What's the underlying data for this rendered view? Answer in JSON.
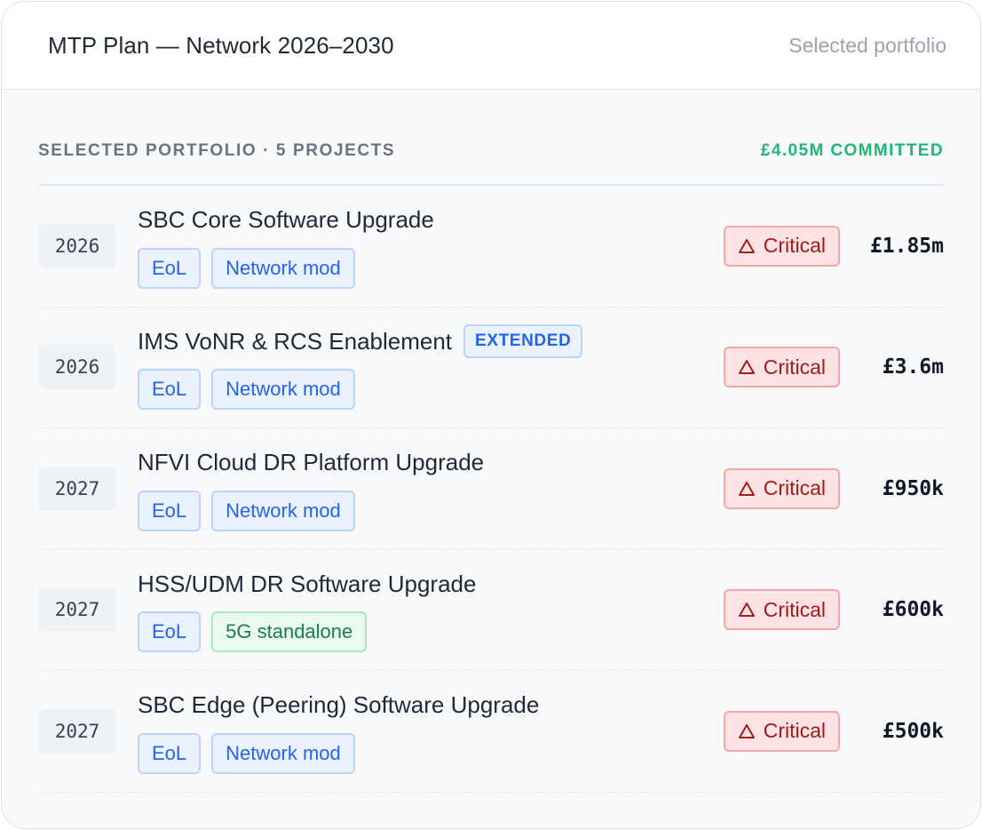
{
  "header": {
    "title": "MTP Plan — Network 2026–2030",
    "context": "Selected portfolio"
  },
  "summary": {
    "label": "SELECTED PORTFOLIO · 5 PROJECTS",
    "committed": "£4.05M COMMITTED"
  },
  "colors": {
    "accent_blue": "#2563eb",
    "committed_green": "#22b573",
    "critical_red": "#a01c1c"
  },
  "projects": [
    {
      "year": "2026",
      "name": "SBC Core Software Upgrade",
      "flag": "",
      "tags": [
        {
          "label": "EoL",
          "style": "blue"
        },
        {
          "label": "Network mod",
          "style": "blue"
        }
      ],
      "priority": "Critical",
      "priority_icon": "warning-triangle-icon",
      "amount": "£1.85m"
    },
    {
      "year": "2026",
      "name": "IMS VoNR & RCS Enablement",
      "flag": "EXTENDED",
      "tags": [
        {
          "label": "EoL",
          "style": "blue"
        },
        {
          "label": "Network mod",
          "style": "blue"
        }
      ],
      "priority": "Critical",
      "priority_icon": "warning-triangle-icon",
      "amount": "£3.6m"
    },
    {
      "year": "2027",
      "name": "NFVI Cloud DR Platform Upgrade",
      "flag": "",
      "tags": [
        {
          "label": "EoL",
          "style": "blue"
        },
        {
          "label": "Network mod",
          "style": "blue"
        }
      ],
      "priority": "Critical",
      "priority_icon": "warning-triangle-icon",
      "amount": "£950k"
    },
    {
      "year": "2027",
      "name": "HSS/UDM DR Software Upgrade",
      "flag": "",
      "tags": [
        {
          "label": "EoL",
          "style": "blue"
        },
        {
          "label": "5G standalone",
          "style": "green"
        }
      ],
      "priority": "Critical",
      "priority_icon": "warning-triangle-icon",
      "amount": "£600k"
    },
    {
      "year": "2027",
      "name": "SBC Edge (Peering) Software Upgrade",
      "flag": "",
      "tags": [
        {
          "label": "EoL",
          "style": "blue"
        },
        {
          "label": "Network mod",
          "style": "blue"
        }
      ],
      "priority": "Critical",
      "priority_icon": "warning-triangle-icon",
      "amount": "£500k"
    }
  ]
}
